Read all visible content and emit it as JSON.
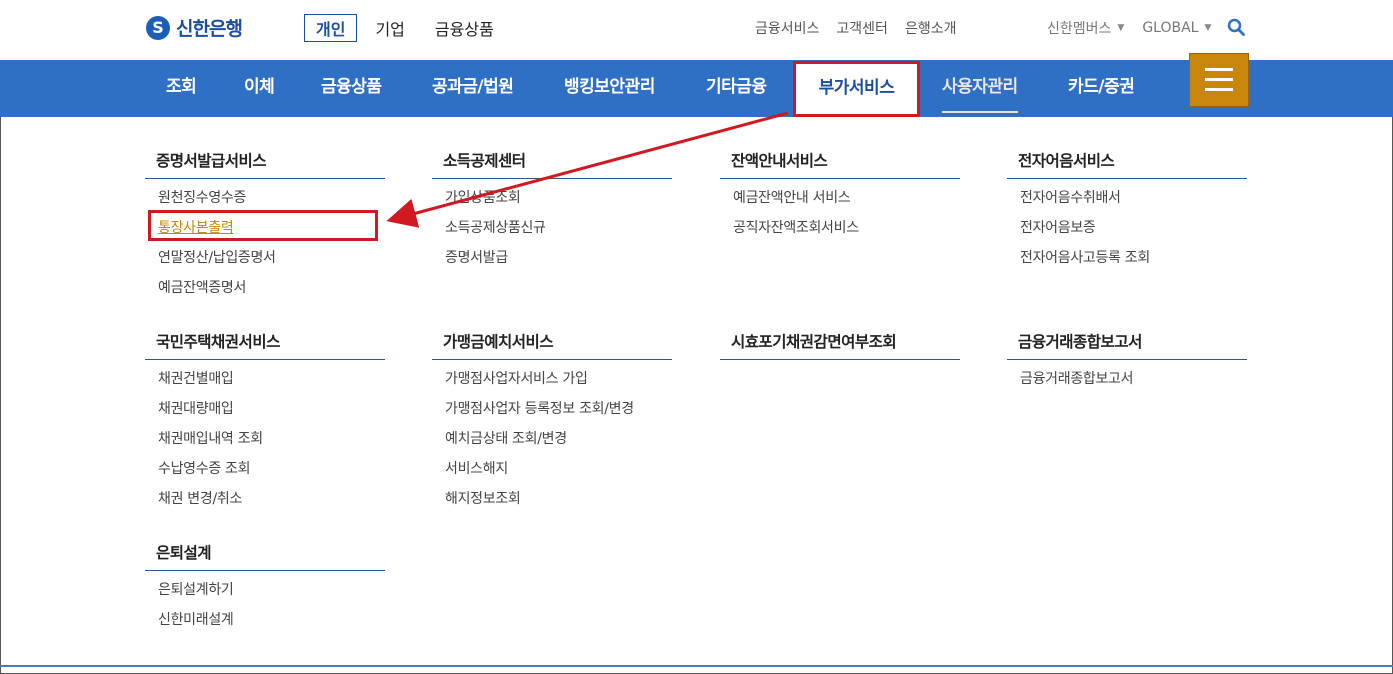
{
  "header": {
    "logo_text": "신한은행",
    "logo_mark": "S",
    "segments": [
      {
        "label": "개인",
        "active": true
      },
      {
        "label": "기업",
        "active": false
      },
      {
        "label": "금융상품",
        "active": false
      }
    ],
    "util_links": [
      "금융서비스",
      "고객센터",
      "은행소개"
    ],
    "members_label": "신한멤버스",
    "global_label": "GLOBAL",
    "search_icon": "search-icon"
  },
  "nav": {
    "items": [
      "조회",
      "이체",
      "금융상품",
      "공과금/법원",
      "뱅킹보안관리",
      "기타금융",
      "부가서비스",
      "사용자관리",
      "카드/증권"
    ],
    "active": "부가서비스",
    "menu_icon": "hamburger-icon"
  },
  "menu": {
    "columns": [
      {
        "title": "증명서발급서비스",
        "items": [
          "원천징수영수증",
          "통장사본출력",
          "연말정산/납입증명서",
          "예금잔액증명서"
        ]
      },
      {
        "title": "소득공제센터",
        "items": [
          "가입상품조회",
          "소득공제상품신규",
          "증명서발급"
        ]
      },
      {
        "title": "잔액안내서비스",
        "items": [
          "예금잔액안내 서비스",
          "공직자잔액조회서비스"
        ]
      },
      {
        "title": "전자어음서비스",
        "items": [
          "전자어음수취배서",
          "전자어음보증",
          "전자어음사고등록 조회"
        ]
      },
      {
        "title": "국민주택채권서비스",
        "items": [
          "채권건별매입",
          "채권대량매입",
          "채권매입내역 조회",
          "수납영수증 조회",
          "채권 변경/취소"
        ]
      },
      {
        "title": "가맹금예치서비스",
        "items": [
          "가맹점사업자서비스 가입",
          "가맹점사업자 등록정보 조회/변경",
          "예치금상태 조회/변경",
          "서비스해지",
          "해지정보조회"
        ]
      },
      {
        "title": "시효포기채권감면여부조회",
        "items": []
      },
      {
        "title": "금융거래종합보고서",
        "items": [
          "금융거래종합보고서"
        ]
      },
      {
        "title": "은퇴설계",
        "items": [
          "은퇴설계하기",
          "신한미래설계"
        ]
      }
    ],
    "highlighted_item": "통장사본출력"
  },
  "colors": {
    "nav_bg": "#2f6fc4",
    "annotation_red": "#d01920",
    "menu_button": "#c8860a",
    "brand_blue": "#1d4e9e"
  }
}
